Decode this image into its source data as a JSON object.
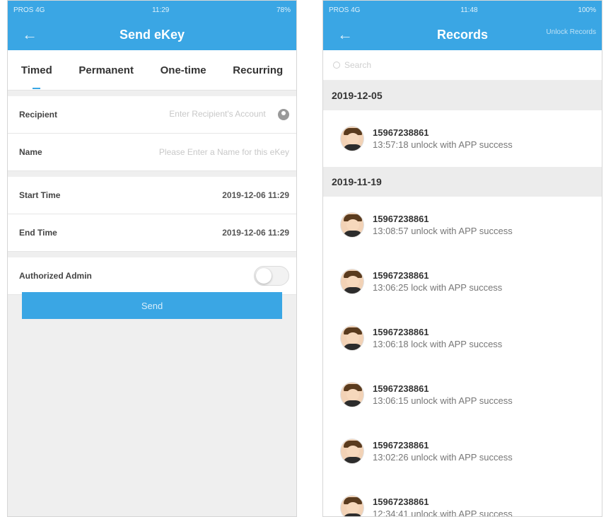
{
  "send_ekey": {
    "title": "Send eKey",
    "status": {
      "carrier": "PROS 4G",
      "time": "11:29",
      "battery": "78%"
    },
    "tabs": [
      "Timed",
      "Permanent",
      "One-time",
      "Recurring"
    ],
    "fields": {
      "recipient": {
        "label": "Recipient",
        "placeholder": "Enter Recipient's Account"
      },
      "name": {
        "label": "Name",
        "placeholder": "Please Enter a Name for this eKey"
      },
      "start_time": {
        "label": "Start Time",
        "value": "2019-12-06 11:29"
      },
      "end_time": {
        "label": "End Time",
        "value": "2019-12-06 11:29"
      },
      "authorized_admin": {
        "label": "Authorized Admin",
        "on": false
      }
    },
    "send_label": "Send"
  },
  "records": {
    "title": "Records",
    "right_action": "Unlock Records",
    "status": {
      "carrier": "PROS 4G",
      "time": "11:48",
      "battery": "100%"
    },
    "search_placeholder": "Search",
    "groups": [
      {
        "date": "2019-12-05",
        "items": [
          {
            "account": "15967238861",
            "desc": "13:57:18 unlock with APP success"
          }
        ]
      },
      {
        "date": "2019-11-19",
        "items": [
          {
            "account": "15967238861",
            "desc": "13:08:57 unlock with APP success"
          },
          {
            "account": "15967238861",
            "desc": "13:06:25 lock with APP success"
          },
          {
            "account": "15967238861",
            "desc": "13:06:18 lock with APP success"
          },
          {
            "account": "15967238861",
            "desc": "13:06:15 unlock with APP success"
          },
          {
            "account": "15967238861",
            "desc": "13:02:26 unlock with APP success"
          },
          {
            "account": "15967238861",
            "desc": "12:34:41 unlock with APP success"
          }
        ]
      }
    ]
  },
  "colors": {
    "accent": "#3aa6e4",
    "background": "#efefef"
  }
}
